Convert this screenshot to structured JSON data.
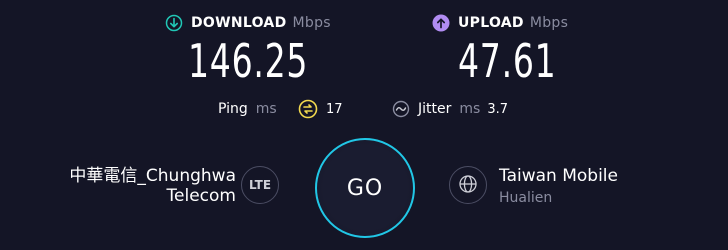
{
  "download": {
    "label": "DOWNLOAD",
    "unit": "Mbps",
    "value": "146.25",
    "accent": "#21c7b6"
  },
  "upload": {
    "label": "UPLOAD",
    "unit": "Mbps",
    "value": "47.61",
    "accent": "#b18cf2"
  },
  "ping": {
    "label": "Ping",
    "unit": "ms",
    "value": "17",
    "accent": "#f2d94e"
  },
  "jitter": {
    "label": "Jitter",
    "unit": "ms",
    "value": "3.7"
  },
  "isp": {
    "line1": "中華電信_Chunghwa",
    "line2": "Telecom",
    "badge": "LTE"
  },
  "go_label": "GO",
  "server": {
    "name": "Taiwan Mobile",
    "location": "Hualien"
  },
  "colors": {
    "background": "#141526",
    "go_ring": "#21c7e6",
    "muted": "#8a8ca0"
  }
}
